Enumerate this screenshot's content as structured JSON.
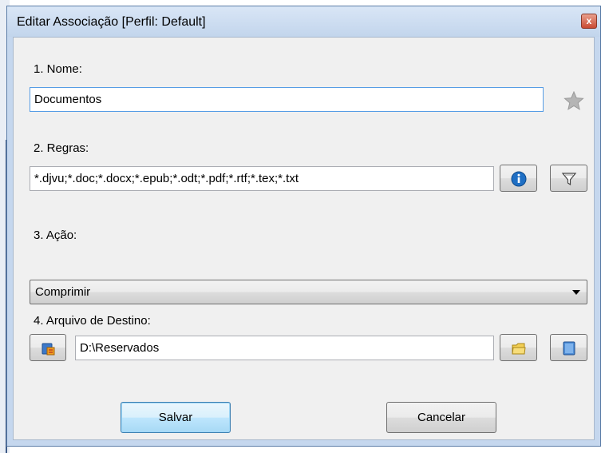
{
  "window": {
    "title": "Editar Associação [Perfil: Default]",
    "close_glyph": "x"
  },
  "fields": {
    "name": {
      "label": "1. Nome:",
      "value": "Documentos"
    },
    "rules": {
      "label": "2. Regras:",
      "value": "*.djvu;*.doc;*.docx;*.epub;*.odt;*.pdf;*.rtf;*.tex;*.txt"
    },
    "action": {
      "label": "3. Ação:",
      "selected": "Comprimir"
    },
    "destination": {
      "label": "4. Arquivo de Destino:",
      "value": "D:\\Reservados"
    }
  },
  "buttons": {
    "save": "Salvar",
    "cancel": "Cancelar"
  },
  "icons": {
    "favorite": "star-icon",
    "rules_info": "info-icon",
    "rules_filter": "filter-icon",
    "dest_left": "archive-icon",
    "dest_browse": "folder-icon",
    "dest_book": "book-icon"
  },
  "colors": {
    "title_bar": "#c5d7ee",
    "info_blue": "#1f6fc4",
    "default_button_border": "#3c7fb1"
  }
}
